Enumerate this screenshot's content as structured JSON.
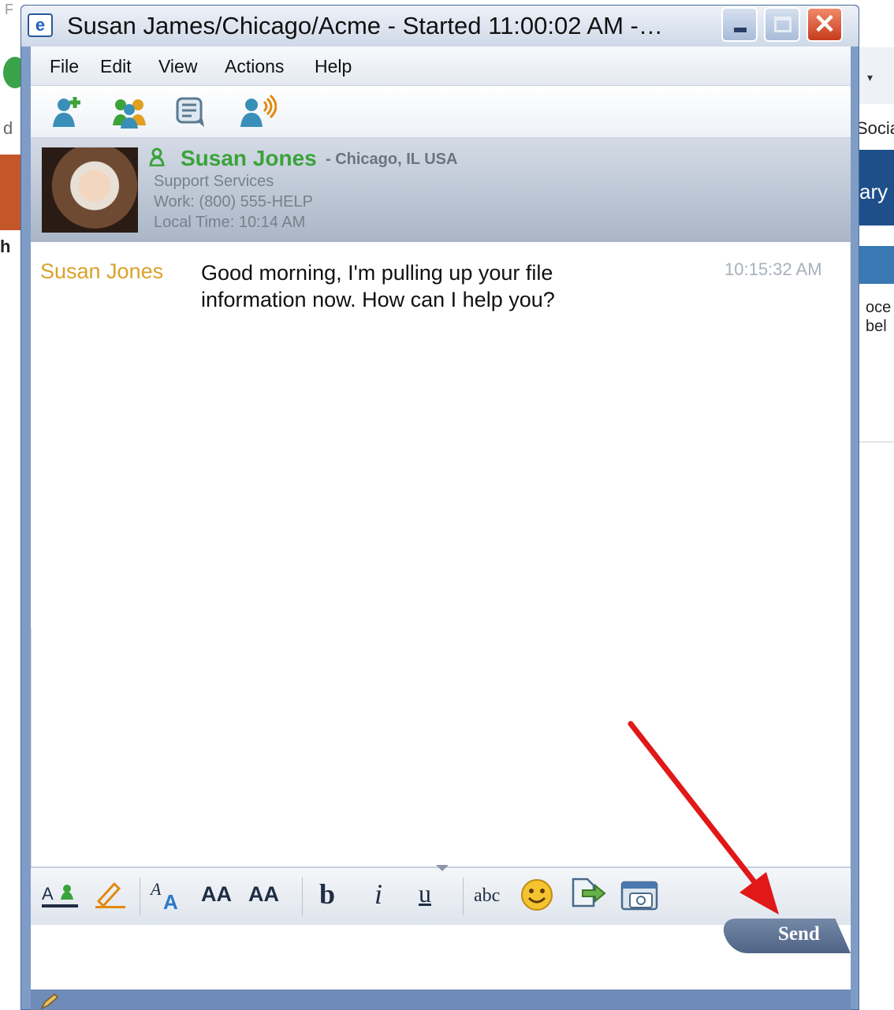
{
  "window": {
    "title": "Susan James/Chicago/Acme - Started 11:00:02 AM -…"
  },
  "menu": {
    "items": [
      "File",
      "Edit",
      "View",
      "Actions",
      "Help"
    ]
  },
  "toolbar": {
    "icons": [
      "add-contact-icon",
      "group-icon",
      "chat-history-icon",
      "voice-call-icon"
    ]
  },
  "contact": {
    "name": "Susan Jones",
    "location": "- Chicago, IL USA",
    "department": "Support Services",
    "work": "Work: (800) 555-HELP",
    "local_time": "Local Time: 10:14 AM"
  },
  "conversation": {
    "messages": [
      {
        "sender": "Susan Jones",
        "text": "Good morning, I'm pulling up your file information now. How can I help you?",
        "time": "10:15:32 AM"
      }
    ]
  },
  "format_bar": {
    "bold": "b",
    "italic": "i",
    "underline": "u",
    "spell": "abc",
    "grow_font": "AA",
    "shrink_font": "AA"
  },
  "send": {
    "label": "Send"
  },
  "colors": {
    "presence": "#3aa33a",
    "sender": "#d9a22b",
    "annotation_arrow": "#e01818"
  }
}
